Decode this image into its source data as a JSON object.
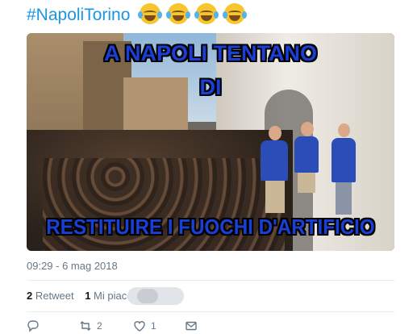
{
  "tweet": {
    "hashtag": "#NapoliTorino",
    "emoji": [
      "face-with-tears-of-joy",
      "face-with-tears-of-joy",
      "face-with-tears-of-joy",
      "face-with-tears-of-joy"
    ]
  },
  "media": {
    "caption_top": "A NAPOLI TENTANO",
    "caption_mid": "DI",
    "caption_bottom": "RESTITUIRE I FUOCHI D'ARTIFICIO"
  },
  "timestamp": "09:29 - 6 mag 2018",
  "stats": {
    "retweet_count": "2",
    "retweet_label": "Retweet",
    "likes_count": "1",
    "likes_label": "Mi piace"
  },
  "actions": {
    "reply_icon": "reply-icon",
    "retweet_icon": "retweet-icon",
    "retweet_count": "2",
    "like_icon": "heart-icon",
    "like_count": "1",
    "message_icon": "envelope-icon"
  },
  "colors": {
    "link": "#1b95e0",
    "caption": "#1a3fd6",
    "muted": "#657786"
  }
}
